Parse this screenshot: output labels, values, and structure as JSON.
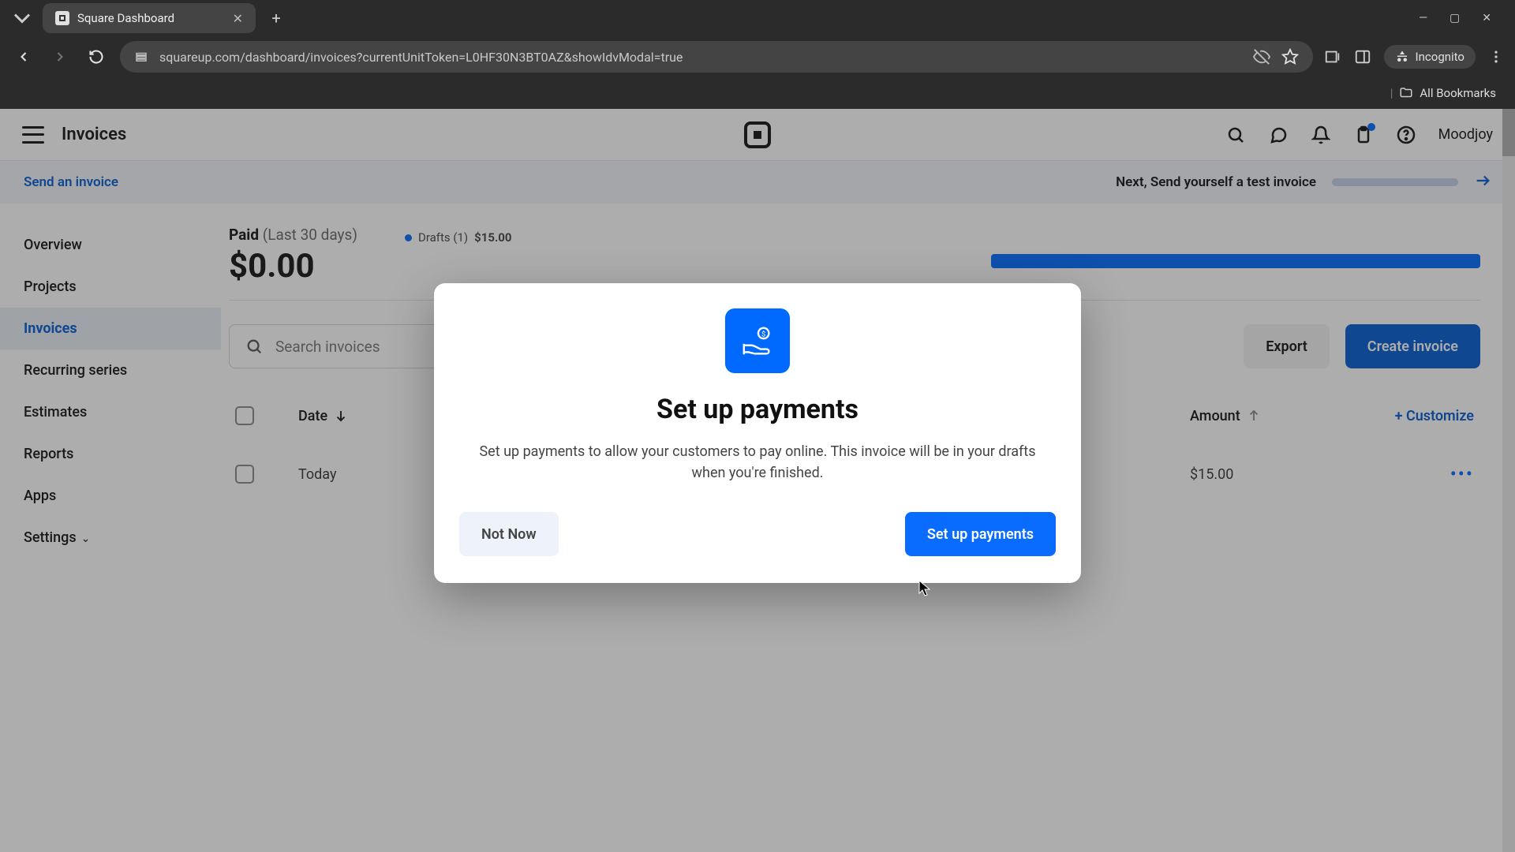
{
  "browser": {
    "tab_title": "Square Dashboard",
    "url": "squareup.com/dashboard/invoices?currentUnitToken=L0HF30N3BT0AZ&showIdvModal=true",
    "incognito_label": "Incognito",
    "all_bookmarks": "All Bookmarks"
  },
  "header": {
    "page_title": "Invoices",
    "username": "Moodjoy"
  },
  "banner": {
    "left": "Send an invoice",
    "right": "Next, Send yourself a test invoice"
  },
  "sidebar": {
    "items": [
      {
        "label": "Overview"
      },
      {
        "label": "Projects"
      },
      {
        "label": "Invoices"
      },
      {
        "label": "Recurring series"
      },
      {
        "label": "Estimates"
      },
      {
        "label": "Reports"
      },
      {
        "label": "Apps"
      },
      {
        "label": "Settings"
      }
    ]
  },
  "stats": {
    "paid_label": "Paid",
    "paid_period": "(Last 30 days)",
    "paid_amount": "$0.00",
    "drafts_label": "Drafts (1)",
    "drafts_amount": "$15.00"
  },
  "search": {
    "placeholder": "Search invoices"
  },
  "actions": {
    "export": "Export",
    "create": "Create invoice",
    "customize": "+ Customize"
  },
  "table": {
    "col_date": "Date",
    "col_amount": "Amount",
    "rows": [
      {
        "date": "Today",
        "amount": "$15.00"
      }
    ]
  },
  "modal": {
    "title": "Set up payments",
    "body": "Set up payments to allow your customers to pay online. This invoice will be in your drafts when you're finished.",
    "not_now": "Not Now",
    "confirm": "Set up payments"
  }
}
